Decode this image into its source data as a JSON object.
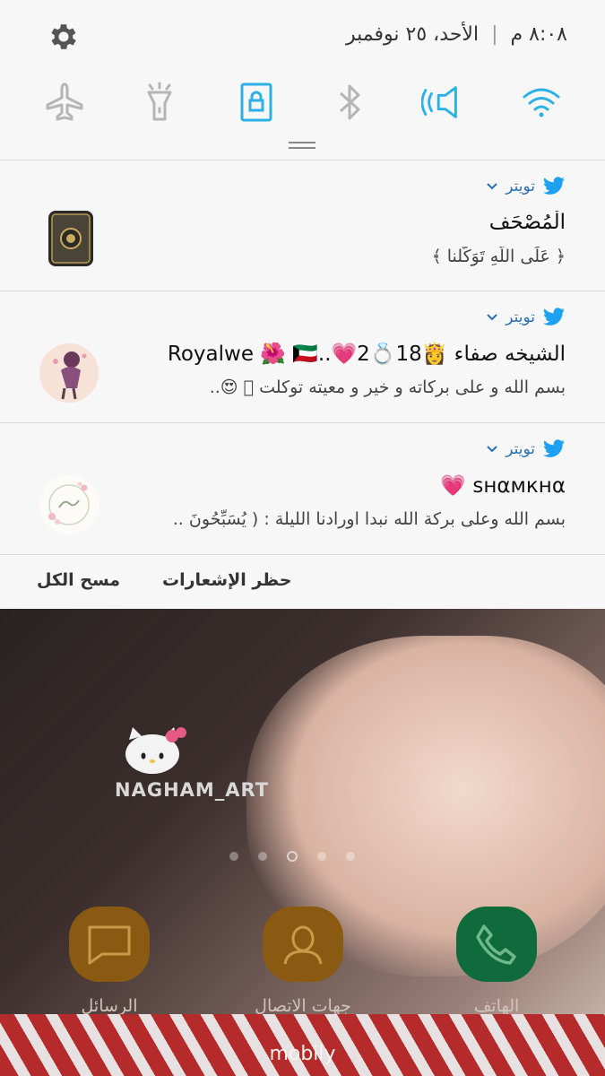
{
  "status_bar": {
    "time": "٨:٠٨ م",
    "separator": "|",
    "date": "الأحد، ٢٥ نوفمبر"
  },
  "quick_toggles": [
    {
      "name": "wifi-icon",
      "active": true
    },
    {
      "name": "sound-icon",
      "active": true
    },
    {
      "name": "bluetooth-icon",
      "active": false
    },
    {
      "name": "screen-rotation-lock-icon",
      "active": true
    },
    {
      "name": "flashlight-icon",
      "active": false
    },
    {
      "name": "airplane-mode-icon",
      "active": false
    }
  ],
  "notifications": [
    {
      "app": "تويتر",
      "title": "الْمُصْحَف",
      "text": "﴿ عَلَى اللَّهِ تَوَكَّلنا ﴾"
    },
    {
      "app": "تويتر",
      "title": "الشيخه صفاء 👸18💍2💗..Royalwe 🌺 🇰🇼",
      "text": "بسم الله و على بركاته و خير و معيته توكلت 🏻 😍.."
    },
    {
      "app": "تويتر",
      "title": "ѕнαмкнα 💗",
      "text": "بسم الله وعلى بركة الله نبدا اورادنا الليلة : ( يُسَبِّحُونَ .."
    }
  ],
  "actions": {
    "block_notifications": "حظر الإشعارات",
    "clear_all": "مسح الكل"
  },
  "home": {
    "watermark": "NAGHAM_ART",
    "apps": [
      {
        "label": "الرسائل",
        "icon": "messages-icon",
        "color": "#8a5a12"
      },
      {
        "label": "جهات الاتصال",
        "icon": "contacts-icon",
        "color": "#8a5a12"
      },
      {
        "label": "الهاتف",
        "icon": "phone-icon",
        "color": "#0f6b3c"
      }
    ],
    "carrier": "mobily"
  },
  "colors": {
    "accent_blue": "#2bb1e6",
    "twitter_blue": "#1da1f2",
    "inactive_icon": "#b5b5b5"
  }
}
